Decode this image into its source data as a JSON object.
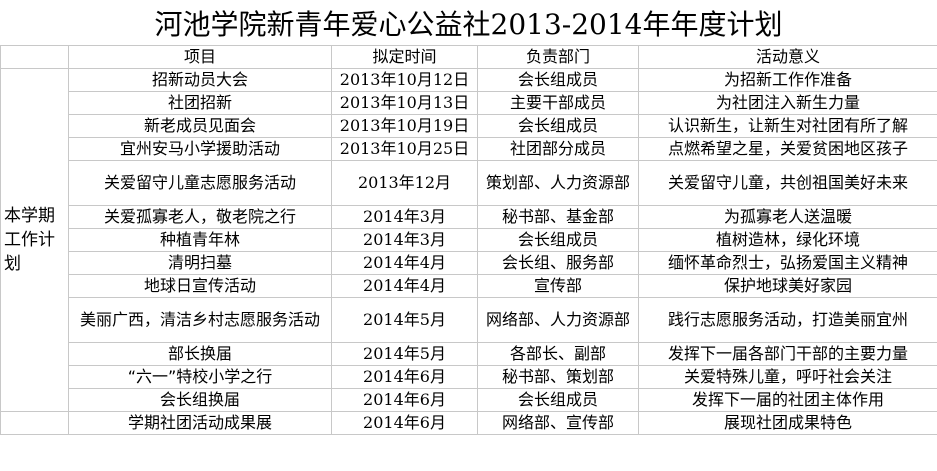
{
  "title": "河池学院新青年爱心公益社2013-2014年年度计划",
  "side_label": "本学期工作计划",
  "headers": [
    "项目",
    "拟定时间",
    "负责部门",
    "活动意义"
  ],
  "rows": [
    {
      "project": "招新动员大会",
      "time": "2013年10月12日",
      "dept": "会长组成员",
      "meaning": "为招新工作作准备"
    },
    {
      "project": "社团招新",
      "time": "2013年10月13日",
      "dept": "主要干部成员",
      "meaning": "为社团注入新生力量"
    },
    {
      "project": "新老成员见面会",
      "time": "2013年10月19日",
      "dept": "会长组成员",
      "meaning": "认识新生，让新生对社团有所了解"
    },
    {
      "project": "宜州安马小学援助活动",
      "time": "2013年10月25日",
      "dept": "社团部分成员",
      "meaning": "点燃希望之星，关爱贫困地区孩子"
    },
    {
      "project": "关爱留守儿童志愿服务活动",
      "time": "2013年12月",
      "dept": "策划部、人力资源部",
      "meaning": "关爱留守儿童，共创祖国美好未来"
    },
    {
      "project": "关爱孤寡老人，敬老院之行",
      "time": "2014年3月",
      "dept": "秘书部、基金部",
      "meaning": "为孤寡老人送温暖"
    },
    {
      "project": "种植青年林",
      "time": "2014年3月",
      "dept": "会长组成员",
      "meaning": "植树造林，绿化环境"
    },
    {
      "project": "清明扫墓",
      "time": "2014年4月",
      "dept": "会长组、服务部",
      "meaning": "缅怀革命烈士，弘扬爱国主义精神"
    },
    {
      "project": "地球日宣传活动",
      "time": "2014年4月",
      "dept": "宣传部",
      "meaning": "保护地球美好家园"
    },
    {
      "project": "美丽广西，清洁乡村志愿服务活动",
      "time": "2014年5月",
      "dept": "网络部、人力资源部",
      "meaning": "践行志愿服务活动，打造美丽宜州"
    },
    {
      "project": "部长换届",
      "time": "2014年5月",
      "dept": "各部长、副部",
      "meaning": "发挥下一届各部门干部的主要力量"
    },
    {
      "project": "“六一”特校小学之行",
      "time": "2014年6月",
      "dept": "秘书部、策划部",
      "meaning": "关爱特殊儿童，呼吁社会关注"
    },
    {
      "project": "会长组换届",
      "time": "2014年6月",
      "dept": "会长组成员",
      "meaning": "发挥下一届的社团主体作用"
    },
    {
      "project": "学期社团活动成果展",
      "time": "2014年6月",
      "dept": "网络部、宣传部",
      "meaning": "展现社团成果特色"
    }
  ]
}
